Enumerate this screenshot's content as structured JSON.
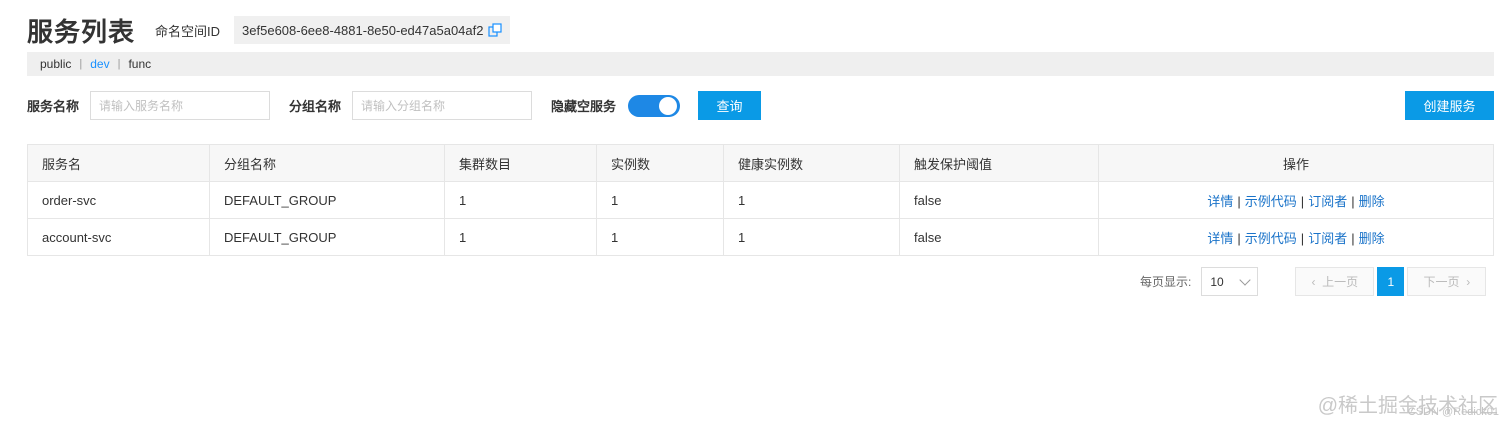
{
  "header": {
    "title": "服务列表",
    "namespace_label": "命名空间ID",
    "namespace_id": "3ef5e608-6ee8-4881-8e50-ed47a5a04af2"
  },
  "namespaces": [
    {
      "label": "public",
      "active": false
    },
    {
      "label": "dev",
      "active": true
    },
    {
      "label": "func",
      "active": false
    }
  ],
  "filters": {
    "service_name_label": "服务名称",
    "service_name_placeholder": "请输入服务名称",
    "group_name_label": "分组名称",
    "group_name_placeholder": "请输入分组名称",
    "hide_empty_label": "隐藏空服务",
    "hide_empty_on": true,
    "query_label": "查询",
    "create_label": "创建服务"
  },
  "table": {
    "columns": [
      "服务名",
      "分组名称",
      "集群数目",
      "实例数",
      "健康实例数",
      "触发保护阈值",
      "操作"
    ],
    "rows": [
      {
        "service": "order-svc",
        "group": "DEFAULT_GROUP",
        "clusters": "1",
        "instances": "1",
        "healthy": "1",
        "protect": "false"
      },
      {
        "service": "account-svc",
        "group": "DEFAULT_GROUP",
        "clusters": "1",
        "instances": "1",
        "healthy": "1",
        "protect": "false"
      }
    ],
    "actions": {
      "detail": "详情",
      "sample_code": "示例代码",
      "subscribers": "订阅者",
      "delete": "删除"
    },
    "action_sep": "|"
  },
  "pagination": {
    "page_size_label": "每页显示:",
    "page_size": "10",
    "prev_label": "上一页",
    "current_page": "1",
    "next_label": "下一页"
  },
  "watermark": {
    "line1": "@稀土掘金技术社区",
    "line2": "CSDN @Redick01"
  },
  "colors": {
    "accent": "#0a9ae6",
    "link": "#1a73c9",
    "toggle": "#1e88e5"
  }
}
